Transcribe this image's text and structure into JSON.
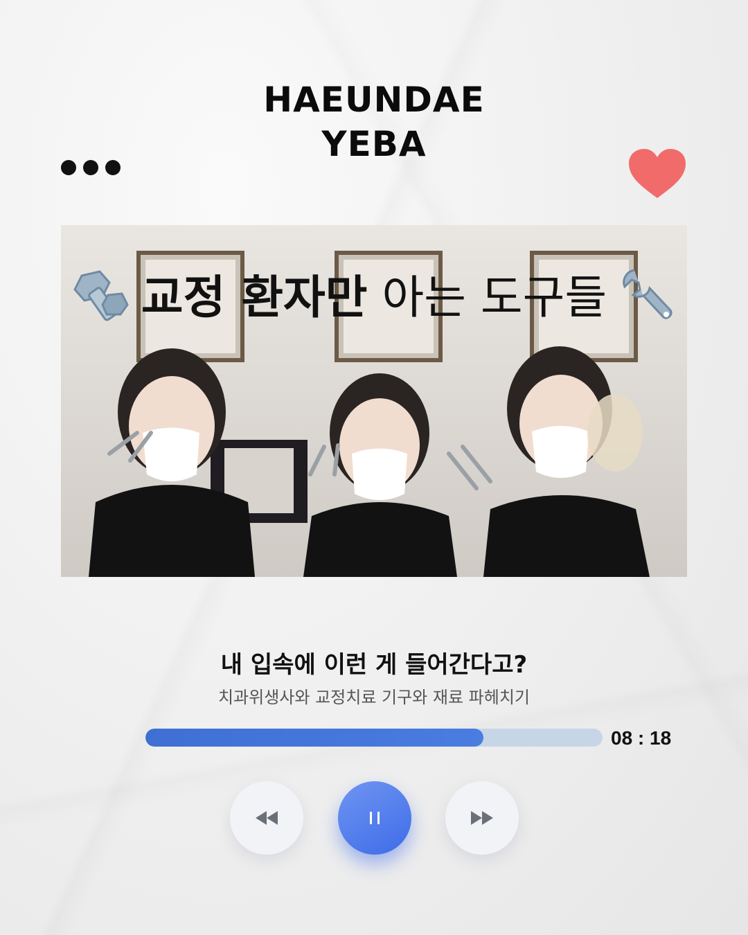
{
  "brand": {
    "line1": "HAEUNDAE",
    "line2": "YEBA"
  },
  "icons": {
    "more": "more-dots-icon",
    "like": "heart-icon",
    "bolt": "nut-and-bolt-icon",
    "wrench": "wrench-icon",
    "rewind": "rewind-icon",
    "pause": "pause-icon",
    "forward": "fast-forward-icon"
  },
  "colors": {
    "heart": "#f26b6b",
    "accent": "#3f6fd3",
    "track": "#c7d6e6"
  },
  "video": {
    "title_bold": "교정 환자만",
    "title_light": "아는 도구들"
  },
  "player": {
    "title": "내 입속에 이런 게 들어간다고?",
    "subtitle": "치과위생사와 교정치료 기구와 재료 파헤치기",
    "time": "08 : 18",
    "progress": 0.74
  }
}
